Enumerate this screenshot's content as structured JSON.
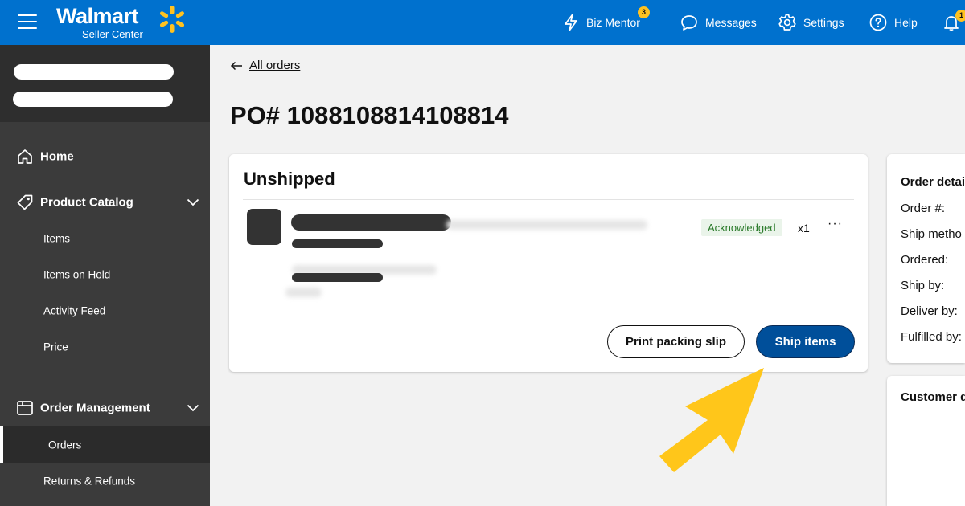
{
  "header": {
    "logo_word": "Walmart",
    "logo_sub": "Seller Center",
    "nav": [
      {
        "label": "Biz Mentor",
        "badge": "3"
      },
      {
        "label": "Messages"
      },
      {
        "label": "Settings"
      },
      {
        "label": "Help"
      }
    ],
    "notifications_badge": "1"
  },
  "sidebar": {
    "sections": [
      {
        "label": "Home"
      },
      {
        "label": "Product Catalog",
        "items": [
          "Items",
          "Items on Hold",
          "Activity Feed",
          "Price"
        ]
      },
      {
        "label": "Order Management",
        "items": [
          "Orders",
          "Returns & Refunds"
        ]
      }
    ]
  },
  "main": {
    "back_link": "All orders",
    "po_title": "PO# 1088108814108814",
    "card": {
      "title": "Unshipped",
      "status": "Acknowledged",
      "quantity": "x1",
      "more": "···",
      "print_button": "Print packing slip",
      "ship_button": "Ship items"
    },
    "order_details": {
      "title": "Order detai",
      "rows": [
        "Order #:",
        "Ship metho",
        "Ordered:",
        "Ship by:",
        "Deliver by:",
        "Fulfilled by:"
      ]
    },
    "customer_details": {
      "title": "Customer d"
    }
  },
  "colors": {
    "header_blue": "#0071ce",
    "spark_yellow": "#ffc220",
    "sidebar_bg": "#3b3b3b",
    "primary_button": "#004f9a",
    "annotation_arrow": "#ffc61a"
  }
}
